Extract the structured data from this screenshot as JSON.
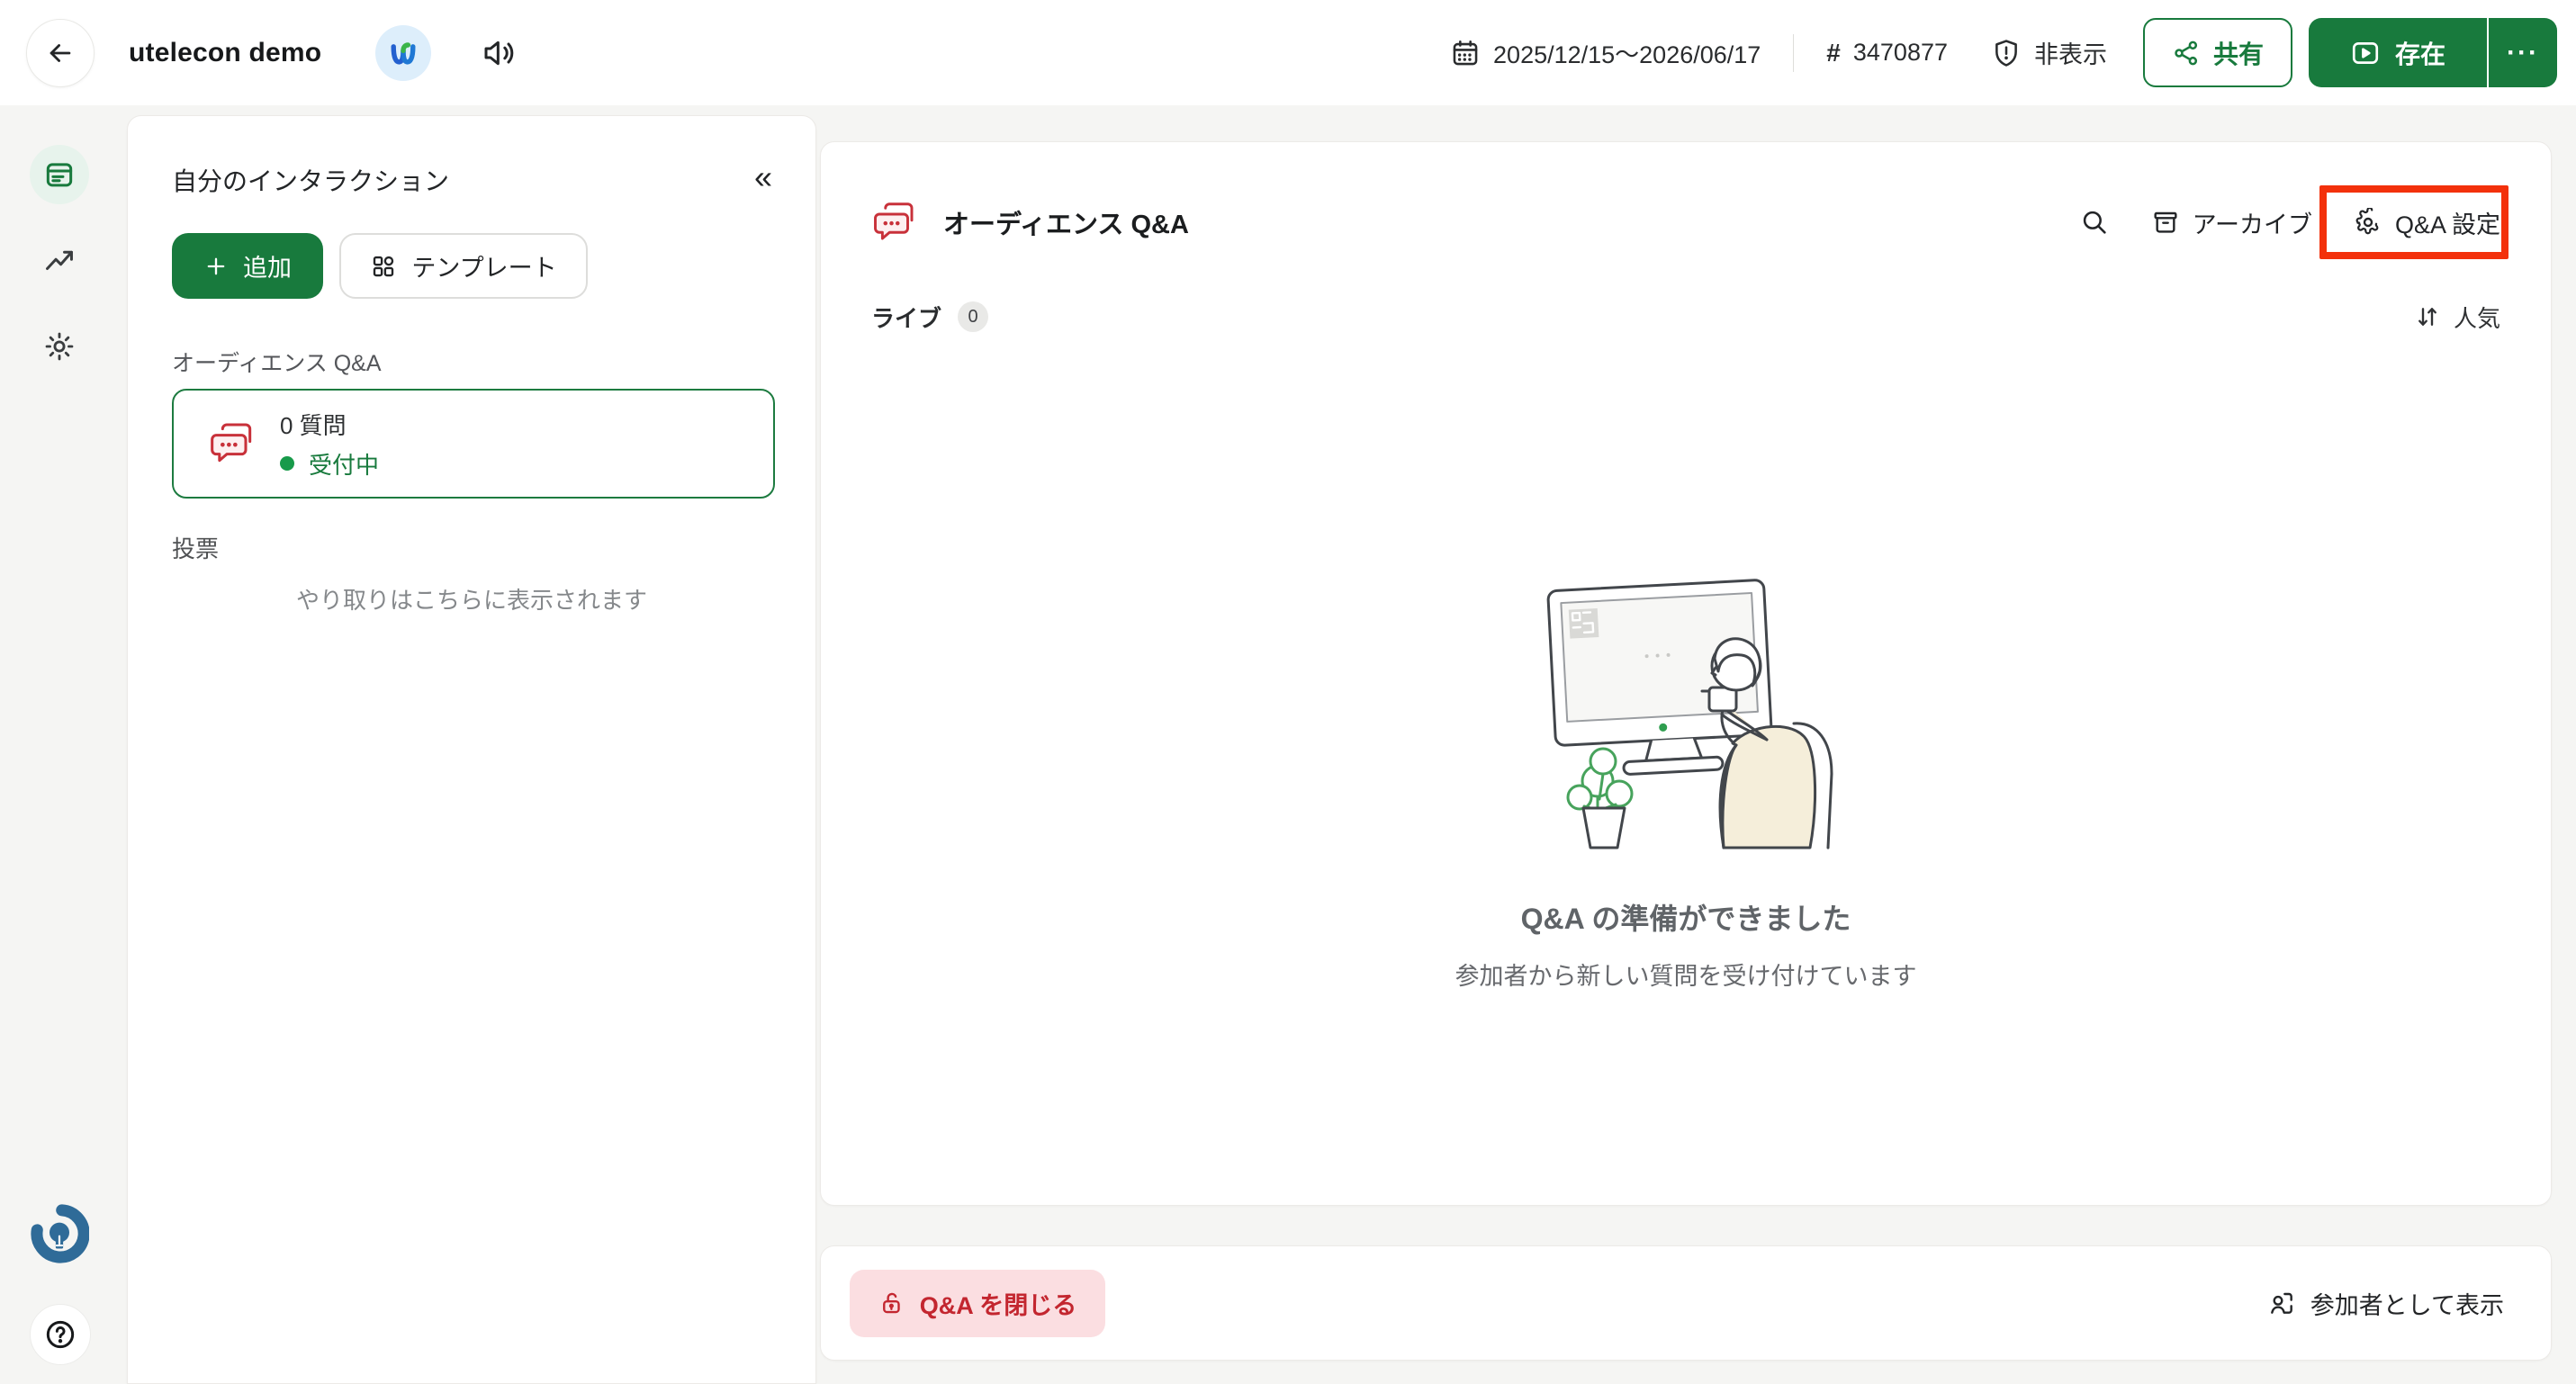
{
  "topbar": {
    "title": "utelecon demo",
    "date_range": "2025/12/15〜2026/06/17",
    "event_code": "3470877",
    "hidden_label": "非表示",
    "share_label": "共有",
    "present_label": "存在"
  },
  "sidebar": {
    "header": "自分のインタラクション",
    "add_label": "追加",
    "template_label": "テンプレート",
    "qa_section_label": "オーディエンス Q&A",
    "qa_card": {
      "count_label": "0 質問",
      "status_label": "受付中"
    },
    "polls_section_label": "投票",
    "placeholder": "やり取りはこちらに表示されます"
  },
  "main": {
    "header_title": "オーディエンス Q&A",
    "archive_label": "アーカイブ",
    "settings_label": "Q&A 設定",
    "live_tab_label": "ライブ",
    "live_count": "0",
    "sort_label": "人気",
    "empty_title": "Q&A の準備ができました",
    "empty_subtitle": "参加者から新しい質問を受け付けています"
  },
  "footer": {
    "close_qa_label": "Q&A を閉じる",
    "view_as_participant_label": "参加者として表示"
  },
  "icons": {
    "hash": "#",
    "more": "···",
    "collapse": "«",
    "plus": "+"
  },
  "colors": {
    "accent_green": "#187a3d",
    "light_green_bg": "#e7f3ec",
    "qa_red": "#c8313a",
    "annotation_red": "#f3310b",
    "close_btn_bg": "#fbdee1",
    "close_btn_text": "#c3262f",
    "webex_badge_bg": "#ddeefb",
    "slido_logo_blue": "#2f6b98",
    "page_bg": "#f5f5f3"
  }
}
